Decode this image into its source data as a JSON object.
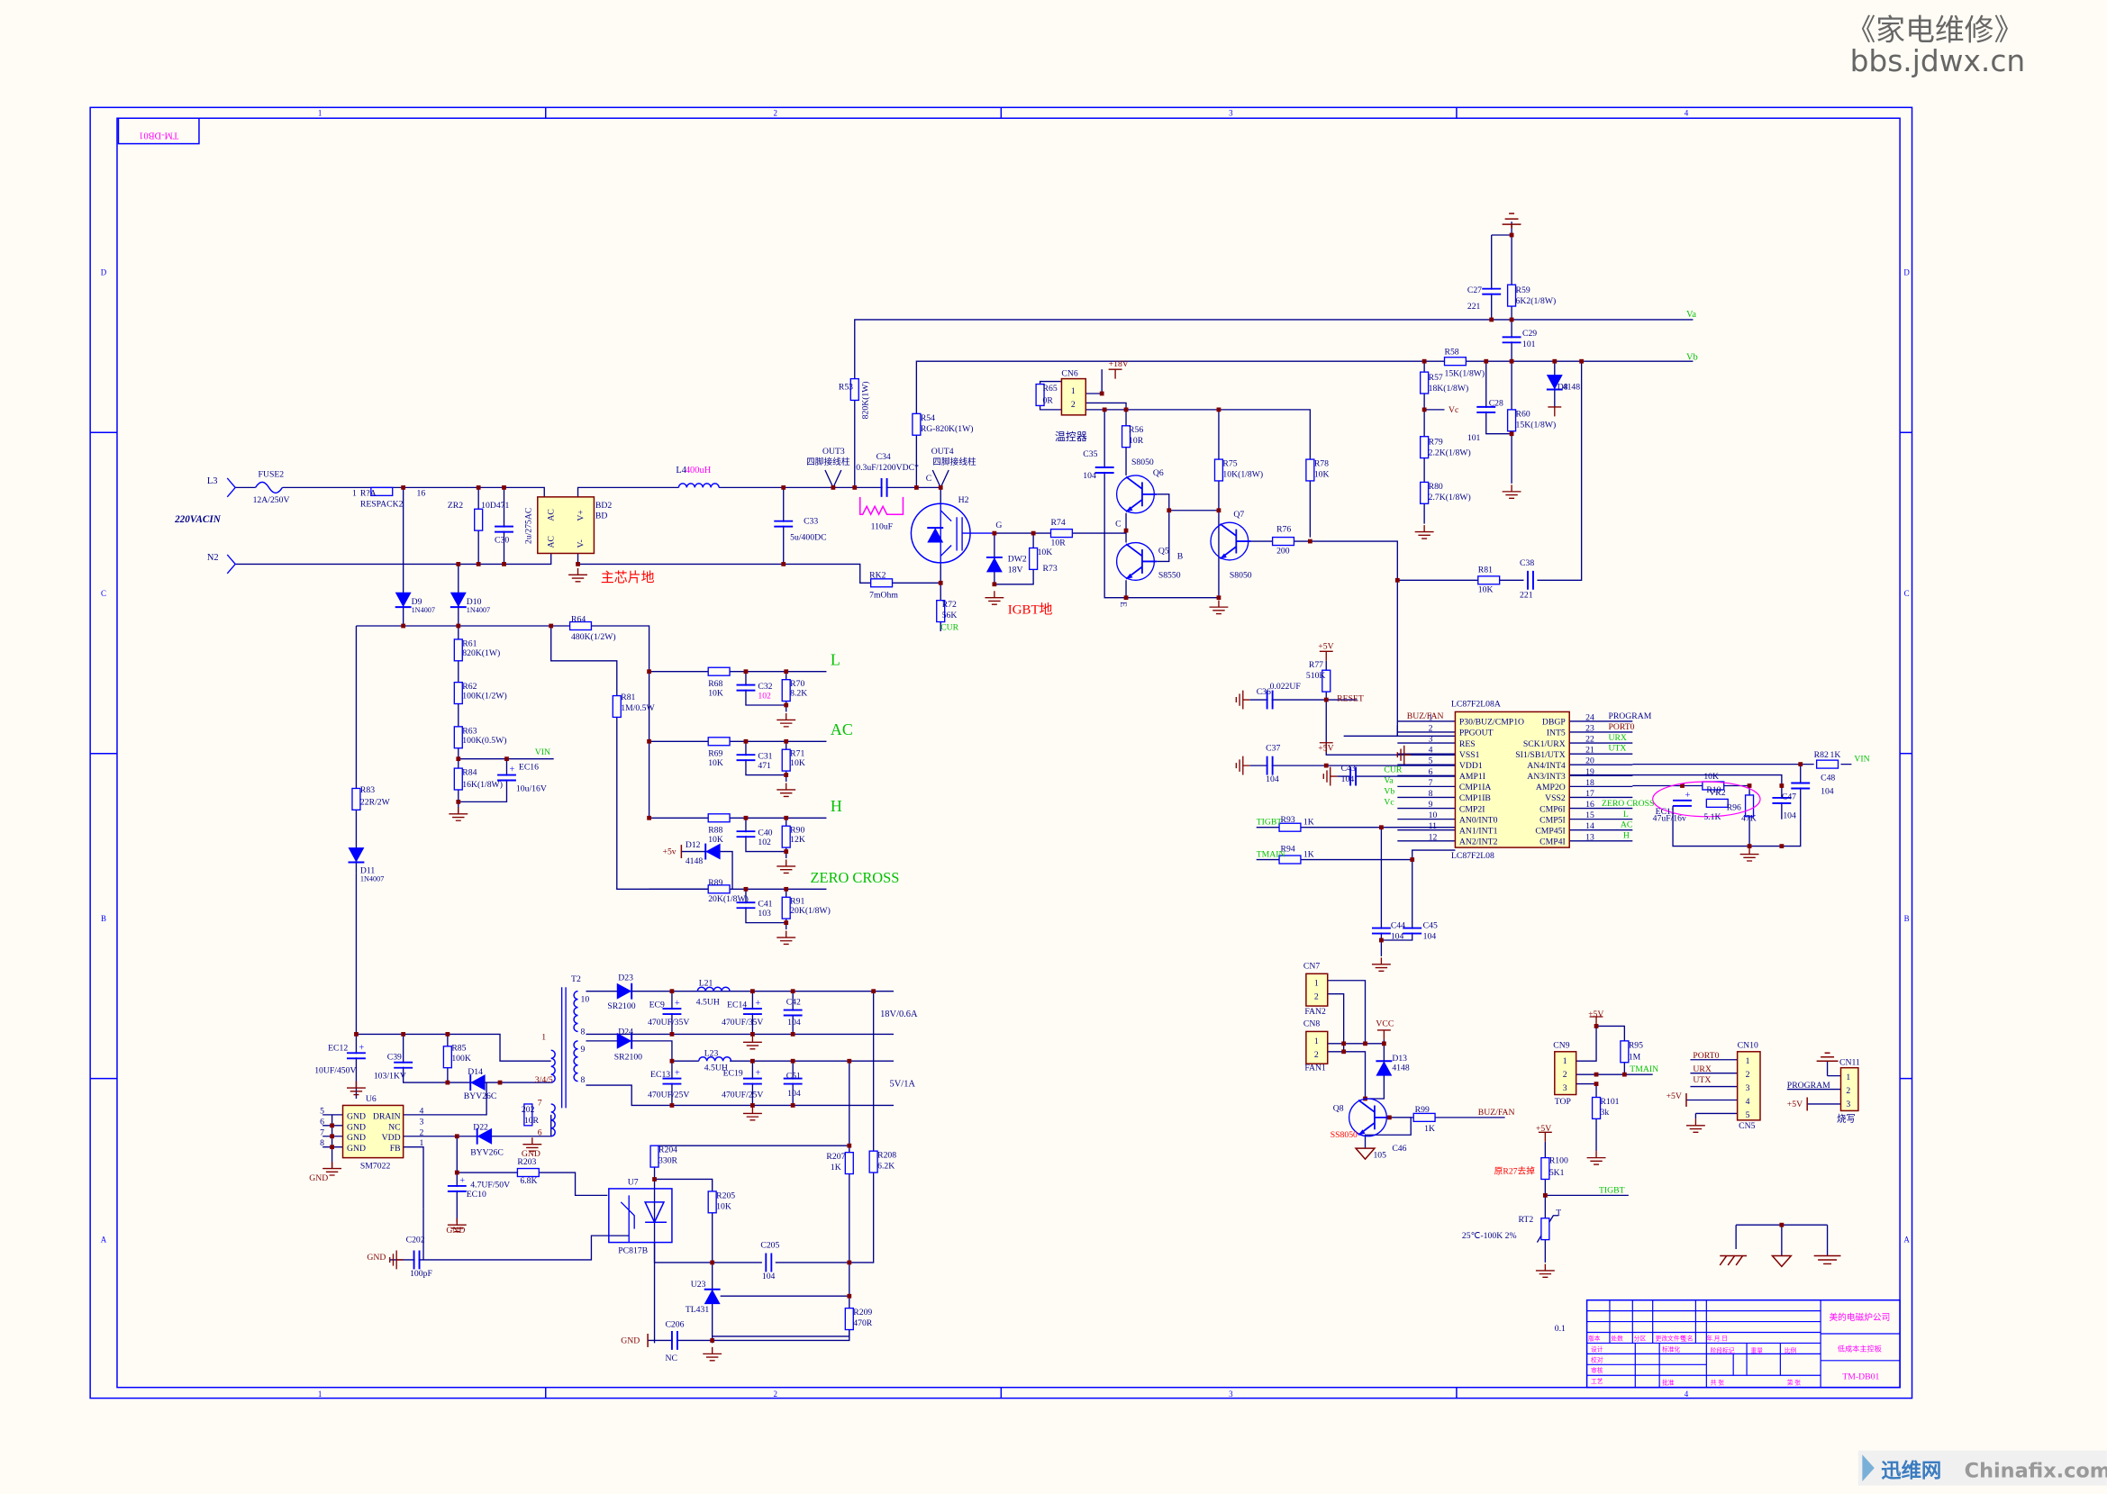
{
  "colors": {
    "background": "#fffcf5",
    "frame": "#0000ff",
    "wire": "#00008b",
    "component": "#0000ff",
    "junction": "#800000",
    "power_symbol": "#800000",
    "net_label": "#00c000",
    "note_red": "#ff0000",
    "note_magenta": "#ff00ff",
    "chip_fill": "#ffffc0",
    "chip_border": "#800000",
    "watermark": "#666666"
  },
  "watermark": {
    "top_line1": "《家电维修》",
    "top_line2": "bbs.jdwx.cn",
    "bottom_brand": "迅维网",
    "bottom_site": "Chinafix.com"
  },
  "frame": {
    "columns": [
      "1",
      "2",
      "3",
      "4"
    ],
    "rows": [
      "D",
      "C",
      "B",
      "A"
    ],
    "corner_label": "TM-DB01"
  },
  "nets": {
    "L3": "L3",
    "N2": "N2",
    "ac_in": "220VACIN",
    "va": "Va",
    "vb": "Vb",
    "vc": "Vc",
    "vin": "VIN",
    "vin_mcu": "VIN",
    "L": "L",
    "AC": "AC",
    "H": "H",
    "zero_cross": "ZERO CROSS",
    "cur": "CUR",
    "plus18": "+18V",
    "plus5": "+5V",
    "plus5v_lower": "+5v",
    "reset": "RESET",
    "tigbt": "TIGBT",
    "tmain": "TMAIN",
    "vcc": "VCC",
    "buz_fan": "BUZ/FAN",
    "gnd": "GND",
    "program": "PROGRAM",
    "port0": "PORT0",
    "urx": "URX",
    "utx": "UTX",
    "out3": "OUT3",
    "out4": "OUT4",
    "post": "四脚接线柱",
    "g": "G",
    "c": "C",
    "b": "B",
    "e": "E",
    "thermistor_t": "T"
  },
  "notes": {
    "chip_gnd": "主芯片地",
    "igbt_gnd": "IGBT地",
    "thermostat": "温控器",
    "r27_note": "原R27去掉",
    "out18": "18V/0.6A",
    "out5": "5V/1A",
    "burn": "烧写",
    "revision": "0.1",
    "coil": "110uF"
  },
  "parts": {
    "FUSE2": [
      "FUSE2",
      "12A/250V"
    ],
    "R7A": [
      "R?A",
      "RESPACK2",
      "1",
      "16"
    ],
    "ZR2": [
      "ZR2",
      "10D471"
    ],
    "C30": [
      "C30",
      "2u/275AC"
    ],
    "BD2": [
      "BD2",
      "BD",
      "AC",
      "AC",
      "V+",
      "V-"
    ],
    "L4": [
      "L4",
      "400uH"
    ],
    "C33": [
      "C33",
      "5u/400DC"
    ],
    "C34": [
      "C34",
      "0.3uF/1200VDC*"
    ],
    "H2": [
      "H2"
    ],
    "RK2": [
      "RK2",
      "7mOhm"
    ],
    "R72": [
      "R72",
      "56K"
    ],
    "R53": [
      "R53",
      "820K(1W)"
    ],
    "R54": [
      "R54",
      "RG-820K(1W)"
    ],
    "CN6": [
      "CN6",
      "1",
      "2"
    ],
    "R65": [
      "R65",
      "0R"
    ],
    "C35": [
      "C35",
      "104"
    ],
    "R56": [
      "R56",
      "10R"
    ],
    "Q6": [
      "Q6",
      "S8050"
    ],
    "Q5": [
      "Q5",
      "S8550"
    ],
    "Q7": [
      "Q7",
      "S8050"
    ],
    "R75": [
      "R75",
      "10K(1/8W)"
    ],
    "R78": [
      "R78",
      "10K"
    ],
    "R76": [
      "R76",
      "200"
    ],
    "R74": [
      "R74",
      "10R"
    ],
    "DW2": [
      "DW2",
      "18V"
    ],
    "R73": [
      "R73",
      "10K"
    ],
    "R58": [
      "R58",
      "15K(1/8W)"
    ],
    "R57": [
      "R57",
      "18K(1/8W)"
    ],
    "R79": [
      "R79",
      "2.2K(1/8W)"
    ],
    "R80": [
      "R80",
      "2.7K(1/8W)"
    ],
    "C28": [
      "C28",
      "101"
    ],
    "R60": [
      "R60",
      "15K(1/8W)"
    ],
    "D8": [
      "D8",
      "4148"
    ],
    "C27": [
      "C27",
      "221"
    ],
    "R59": [
      "R59",
      "6K2(1/8W)"
    ],
    "C29": [
      "C29",
      "101"
    ],
    "R81b": [
      "R81",
      "10K"
    ],
    "C38": [
      "C38",
      "221"
    ],
    "D9": [
      "D9",
      "1N4007"
    ],
    "D10": [
      "D10",
      "1N4007"
    ],
    "R64": [
      "R64",
      "480K(1/2W)"
    ],
    "R61": [
      "R61",
      "820K(1W)"
    ],
    "R62": [
      "R62",
      "100K(1/2W)"
    ],
    "R63": [
      "R63",
      "100K(0.5W)"
    ],
    "R84": [
      "R84",
      "16K(1/8W)"
    ],
    "EC16": [
      "EC16",
      "10u/16V"
    ],
    "R81": [
      "R81",
      "1M/0.5W"
    ],
    "R83": [
      "R83",
      "22R/2W"
    ],
    "D11": [
      "D11",
      "1N4007"
    ],
    "R68": [
      "R68",
      "10K"
    ],
    "C32": [
      "C32",
      "102"
    ],
    "R70": [
      "R70",
      "8.2K"
    ],
    "R69": [
      "R69",
      "10K"
    ],
    "C31": [
      "C31",
      "471"
    ],
    "R71": [
      "R71",
      "10K"
    ],
    "R88": [
      "R88",
      "10K"
    ],
    "C40": [
      "C40",
      "102"
    ],
    "R90": [
      "R90",
      "12K"
    ],
    "D12": [
      "D12",
      "4148"
    ],
    "R89": [
      "R89",
      "20K(1/8W)"
    ],
    "C41": [
      "C41",
      "103"
    ],
    "R91": [
      "R91",
      "20K(1/8W)"
    ],
    "R77": [
      "R77",
      "510K"
    ],
    "C36": [
      "C36",
      "0.022UF"
    ],
    "C37": [
      "C37",
      "104"
    ],
    "C43": [
      "C43",
      "104"
    ],
    "R93": [
      "R93",
      "1K"
    ],
    "R94": [
      "R94",
      "1K"
    ],
    "C44": [
      "C44",
      "104"
    ],
    "C45": [
      "C45",
      "104"
    ],
    "R82": [
      "R82",
      "1K"
    ],
    "C48": [
      "C48",
      "104"
    ],
    "C47": [
      "C47",
      "104"
    ],
    "VR2": [
      "VR2",
      "10K"
    ],
    "R10": [
      "R10",
      "5.1K"
    ],
    "R96": [
      "R96",
      "47K"
    ],
    "EC11": [
      "EC11",
      "47uF/16v"
    ],
    "CN7": [
      "CN7",
      "FAN2",
      "1",
      "2"
    ],
    "CN8": [
      "CN8",
      "FAN1",
      "1",
      "2"
    ],
    "D13": [
      "D13",
      "4148"
    ],
    "Q8": [
      "Q8",
      "SS8050"
    ],
    "C46": [
      "C46",
      "105"
    ],
    "R99": [
      "R99",
      "1K"
    ],
    "CN9": [
      "CN9",
      "TOP",
      "1",
      "2",
      "3"
    ],
    "R95": [
      "R95",
      "1M"
    ],
    "R101": [
      "R101",
      "3k"
    ],
    "CN10": [
      "CN10",
      "CN5",
      "1",
      "2",
      "3",
      "4",
      "5"
    ],
    "CN11": [
      "CN11",
      "1",
      "2",
      "3"
    ],
    "R100": [
      "R100",
      "5K1"
    ],
    "RT2": [
      "RT2",
      "25℃-100K 2%"
    ],
    "EC12": [
      "EC12",
      "10UF/450V"
    ],
    "C39": [
      "C39",
      "103/1KV"
    ],
    "R85": [
      "R85",
      "100K"
    ],
    "D14": [
      "D14",
      "BYV26C"
    ],
    "T2": [
      "T2",
      "10",
      "8",
      "9",
      "8",
      "1",
      "3/4/5",
      "7",
      "6"
    ],
    "U6": [
      "U6",
      "SM7022",
      "GND",
      "GND",
      "GND",
      "GND",
      "DRAIN",
      "NC",
      "VDD",
      "FB",
      "5",
      "6",
      "7",
      "8",
      "4",
      "3",
      "2",
      "1"
    ],
    "D22": [
      "D22",
      "BYV26C"
    ],
    "R202": [
      "202",
      "10R"
    ],
    "R203": [
      "R203",
      "6.8K"
    ],
    "EC10": [
      "EC10",
      "4.7UF/50V"
    ],
    "C202": [
      "C202",
      "100pF"
    ],
    "D23": [
      "D23",
      "SR2100"
    ],
    "D24": [
      "D24",
      "SR2100"
    ],
    "L21": [
      "L21",
      "4.5UH"
    ],
    "L23": [
      "L23",
      "4.5UH"
    ],
    "EC9": [
      "EC9",
      "470UF/35V"
    ],
    "EC14": [
      "EC14",
      "470UF/35V"
    ],
    "C42": [
      "C42",
      "104"
    ],
    "EC13": [
      "EC13",
      "470UF/25V"
    ],
    "EC19": [
      "EC19",
      "470UF/25V"
    ],
    "C51": [
      "C51",
      "104"
    ],
    "R204": [
      "R204",
      "330R"
    ],
    "U7": [
      "U7",
      "PC817B"
    ],
    "R205": [
      "R205",
      "10K"
    ],
    "R207": [
      "R207",
      "1K"
    ],
    "R208": [
      "R208",
      "6.2K"
    ],
    "C205": [
      "C205",
      "104"
    ],
    "U23": [
      "U23",
      "TL431"
    ],
    "R209": [
      "R209",
      "470R"
    ],
    "C206": [
      "C206",
      "NC"
    ]
  },
  "mcu": {
    "top_label": "LC87F2L08A",
    "bottom_label": "LC87F2L08",
    "left_pins": [
      {
        "num": "1",
        "name": "P30/BUZ/CMP1O",
        "net": "BUZ/FAN"
      },
      {
        "num": "2",
        "name": "PPGOUT",
        "net": ""
      },
      {
        "num": "3",
        "name": "RES",
        "net": ""
      },
      {
        "num": "4",
        "name": "VSS1",
        "net": ""
      },
      {
        "num": "5",
        "name": "VDD1",
        "net": ""
      },
      {
        "num": "6",
        "name": "AMP1I",
        "net": "CUR"
      },
      {
        "num": "7",
        "name": "CMP1IA",
        "net": "Va"
      },
      {
        "num": "8",
        "name": "CMP1IB",
        "net": "Vb"
      },
      {
        "num": "9",
        "name": "CMP2I",
        "net": "Vc"
      },
      {
        "num": "10",
        "name": "AN0/INT0",
        "net": ""
      },
      {
        "num": "11",
        "name": "AN1/INT1",
        "net": ""
      },
      {
        "num": "12",
        "name": "AN2/INT2",
        "net": ""
      }
    ],
    "right_pins": [
      {
        "num": "24",
        "name": "DBGP",
        "net": "PROGRAM"
      },
      {
        "num": "23",
        "name": "INT5",
        "net": "PORT0"
      },
      {
        "num": "22",
        "name": "SCK1/URX",
        "net": "URX"
      },
      {
        "num": "21",
        "name": "SI1/SB1/UTX",
        "net": "UTX"
      },
      {
        "num": "20",
        "name": "AN4/INT4",
        "net": ""
      },
      {
        "num": "19",
        "name": "AN3/INT3",
        "net": ""
      },
      {
        "num": "18",
        "name": "AMP2O",
        "net": ""
      },
      {
        "num": "17",
        "name": "VSS2",
        "net": ""
      },
      {
        "num": "16",
        "name": "CMP6I",
        "net": "ZERO CROSS"
      },
      {
        "num": "15",
        "name": "CMP5I",
        "net": "L"
      },
      {
        "num": "14",
        "name": "CMP45I",
        "net": "AC"
      },
      {
        "num": "13",
        "name": "CMP4I",
        "net": "H"
      }
    ]
  },
  "title_block": {
    "company": "美的电磁炉公司",
    "board": "低成本主控板",
    "drawing_no": "TM-DB01",
    "sheet_col": "4",
    "headers": [
      "版本",
      "处数",
      "分区",
      "更改文件号",
      "签名",
      "年.月.日"
    ],
    "roles": [
      "设计",
      "校对",
      "审核",
      "工艺"
    ],
    "std": "标准化",
    "approve": "批准",
    "stage": "阶段标记",
    "weight": "重量",
    "scale": "比例",
    "total": "共 张",
    "page": "第 张"
  }
}
